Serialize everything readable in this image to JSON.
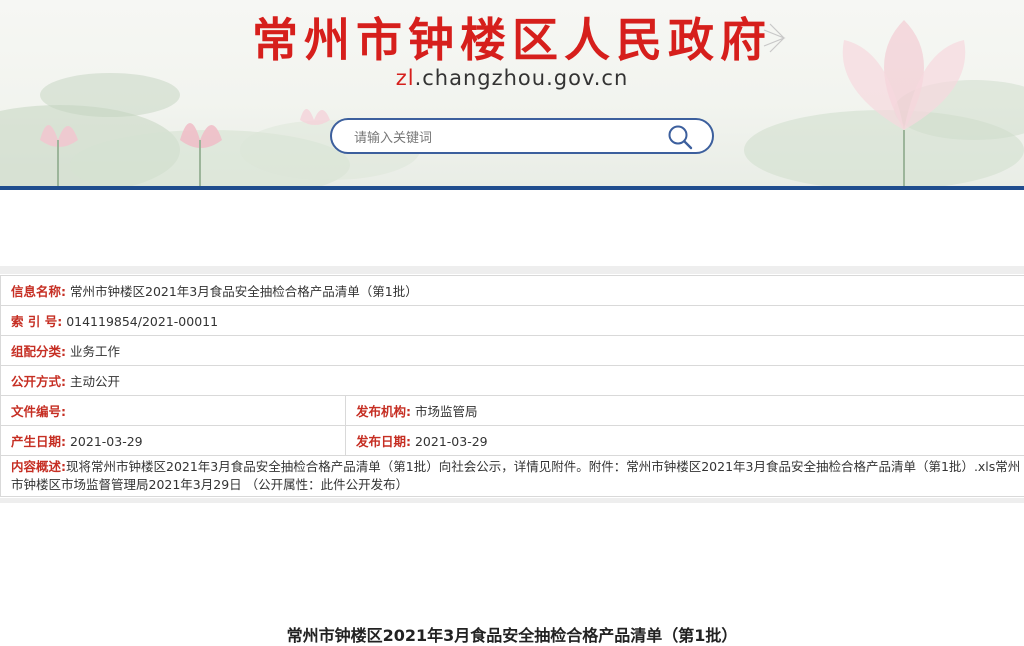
{
  "header": {
    "site_title": "常州市钟楼区人民政府",
    "domain_prefix": "zl",
    "domain_rest": ".changzhou.gov.cn",
    "search": {
      "placeholder": "请输入关键词",
      "value": ""
    },
    "colors": {
      "title_red": "#d61f1c",
      "border_blue": "#3c5f9d"
    }
  },
  "info": {
    "name": {
      "label": "信息名称:",
      "value": "常州市钟楼区2021年3月食品安全抽检合格产品清单（第1批）"
    },
    "index": {
      "label": "索 引 号:",
      "value": "014119854/2021-00011"
    },
    "category": {
      "label": "组配分类:",
      "value": "业务工作"
    },
    "disclosure": {
      "label": "公开方式:",
      "value": "主动公开"
    },
    "doc_no": {
      "label": "文件编号:",
      "value": ""
    },
    "publisher": {
      "label": "发布机构:",
      "value": "市场监管局"
    },
    "created": {
      "label": "产生日期:",
      "value": "2021-03-29"
    },
    "published": {
      "label": "发布日期:",
      "value": "2021-03-29"
    },
    "summary": {
      "label": "内容概述:",
      "value": "现将常州市钟楼区2021年3月食品安全抽检合格产品清单（第1批）向社会公示，详情见附件。附件：常州市钟楼区2021年3月食品安全抽检合格产品清单（第1批）.xls常州市钟楼区市场监督管理局2021年3月29日 （公开属性：此件公开发布）"
    }
  },
  "article": {
    "title": "常州市钟楼区2021年3月食品安全抽检合格产品清单（第1批）"
  }
}
